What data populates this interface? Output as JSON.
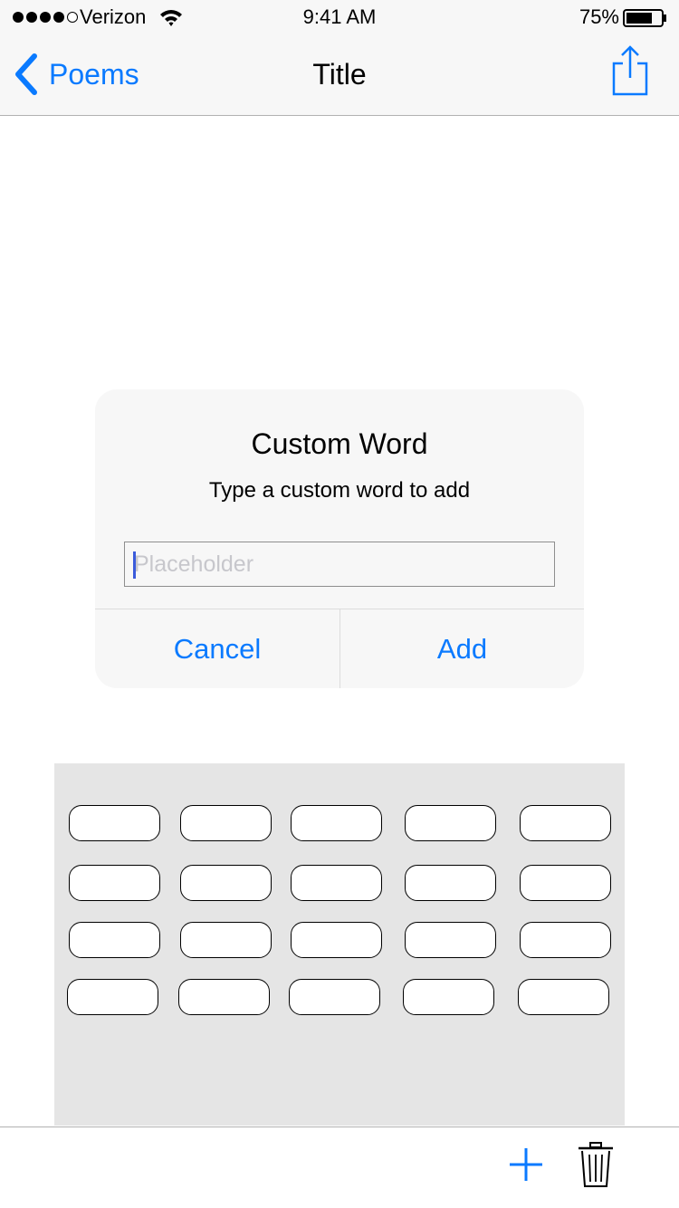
{
  "status_bar": {
    "carrier": "Verizon",
    "time": "9:41 AM",
    "battery_percent": "75%",
    "signal_bars_filled": 4,
    "signal_bars_total": 5
  },
  "nav": {
    "back_label": "Poems",
    "title": "Title",
    "accent_color": "#0a7aff"
  },
  "alert": {
    "title": "Custom Word",
    "message": "Type a custom word to add",
    "input_placeholder": "Placeholder",
    "input_value": "",
    "cancel_label": "Cancel",
    "add_label": "Add"
  },
  "word_grid": {
    "rows": 4,
    "columns": 5,
    "chip_labels": [
      "",
      "",
      "",
      "",
      "",
      "",
      "",
      "",
      "",
      "",
      "",
      "",
      "",
      "",
      "",
      "",
      "",
      "",
      "",
      ""
    ]
  },
  "toolbar": {
    "icons": [
      "plus-icon",
      "trash-icon"
    ]
  }
}
